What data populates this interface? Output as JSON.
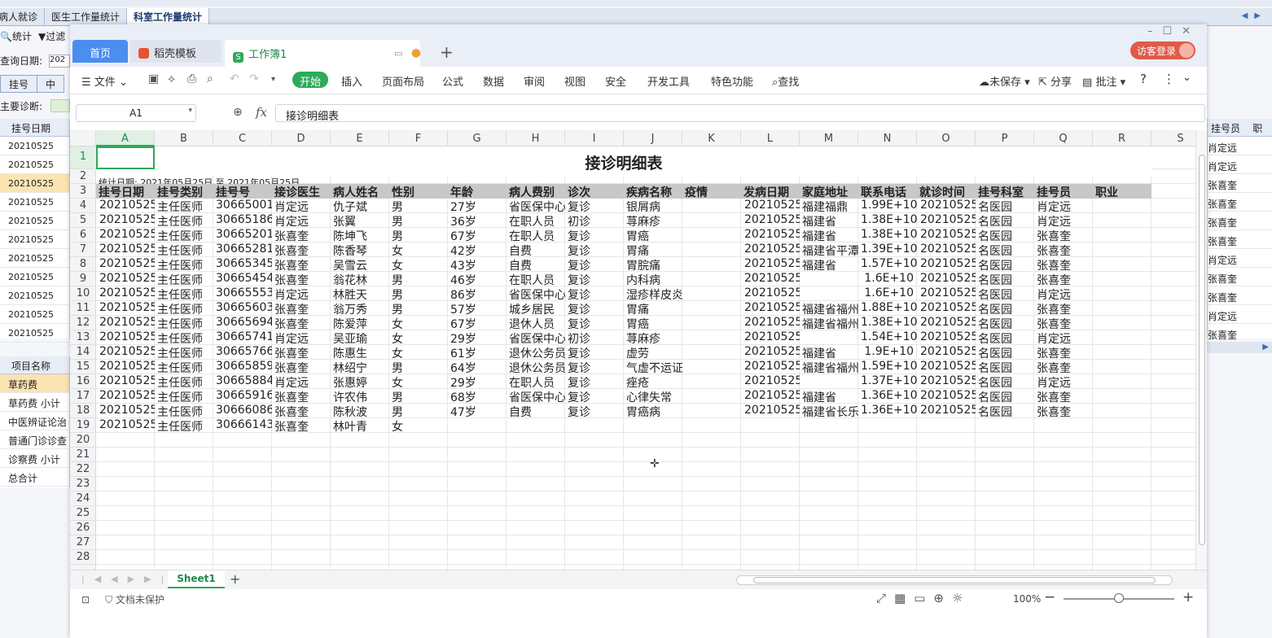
{
  "host": {
    "tabs": [
      "病人就诊",
      "医生工作量统计",
      "科室工作量统计"
    ],
    "toolbar": {
      "stat": "统计",
      "filter": "过滤"
    },
    "query_label": "查询日期:",
    "query_value": "202",
    "subtabs": [
      "挂号",
      "中"
    ],
    "diag_label": "主要诊断:",
    "left_grid": {
      "header": "挂号日期",
      "rows": [
        "20210525",
        "20210525",
        "20210525",
        "20210525",
        "20210525",
        "20210525",
        "20210525",
        "20210525",
        "20210525",
        "20210525",
        "20210525"
      ]
    },
    "right_grid": {
      "header": "挂号员",
      "header2": "职",
      "rows": [
        "肖定远",
        "肖定远",
        "张喜奎",
        "张喜奎",
        "张喜奎",
        "张喜奎",
        "肖定远",
        "张喜奎",
        "张喜奎",
        "肖定远",
        "张喜奎"
      ]
    },
    "items": {
      "header": "项目名称",
      "rows": [
        "草药费",
        "草药费 小计",
        "中医辨证论治",
        "普通门诊诊查",
        "诊察费 小计",
        "总合计"
      ]
    }
  },
  "wps": {
    "tabs": {
      "home": "首页",
      "template": "稻壳模板",
      "workbook": "工作簿1"
    },
    "login": "访客登录",
    "ribbon": {
      "file": "文件",
      "start": "开始",
      "insert": "插入",
      "layout": "页面布局",
      "formula": "公式",
      "data": "数据",
      "review": "审阅",
      "view": "视图",
      "security": "安全",
      "dev": "开发工具",
      "special": "特色功能",
      "search": "查找",
      "unsaved": "未保存",
      "share": "分享",
      "comment": "批注"
    },
    "namebox": "A1",
    "fx": "fx",
    "formula": "接诊明细表",
    "sheet_tab": "Sheet1",
    "status": {
      "doc": "文档未保护",
      "zoom": "100%"
    }
  },
  "sheet": {
    "columns": [
      "A",
      "B",
      "C",
      "D",
      "E",
      "F",
      "G",
      "H",
      "I",
      "J",
      "K",
      "L",
      "M",
      "N",
      "O",
      "P",
      "Q",
      "R",
      "S"
    ],
    "rows": [
      "1",
      "2",
      "3",
      "4",
      "5",
      "6",
      "7",
      "8",
      "9",
      "10",
      "11",
      "12",
      "13",
      "14",
      "15",
      "16",
      "17",
      "18",
      "19",
      "20",
      "21",
      "22",
      "23",
      "24",
      "25",
      "26",
      "27",
      "28"
    ],
    "title": "接诊明细表",
    "stat_line": "统计日期: 2021年05月25日 至 2021年05月25日",
    "headers": [
      "挂号日期",
      "挂号类别",
      "挂号号",
      "接诊医生",
      "病人姓名",
      "性别",
      "年龄",
      "病人费别",
      "诊次",
      "疾病名称",
      "疫情",
      "发病日期",
      "家庭地址",
      "联系电话",
      "就诊时间",
      "挂号科室",
      "挂号员",
      "职业"
    ],
    "data": [
      [
        "20210525",
        "主任医师",
        "30665001",
        "肖定远",
        "仇子斌",
        "男",
        "27岁",
        "省医保中心",
        "复诊",
        "银屑病",
        "",
        "20210525",
        "福建福鼎",
        "1.99E+10",
        "20210525",
        "名医园",
        "肖定远",
        ""
      ],
      [
        "20210525",
        "主任医师",
        "30665186",
        "肖定远",
        "张翼",
        "男",
        "36岁",
        "在职人员",
        "初诊",
        "荨麻疹",
        "",
        "20210525",
        "福建省",
        "1.38E+10",
        "20210525",
        "名医园",
        "肖定远",
        ""
      ],
      [
        "20210525",
        "主任医师",
        "30665201",
        "张喜奎",
        "陈坤飞",
        "男",
        "67岁",
        "在职人员",
        "复诊",
        "胃癌",
        "",
        "20210525",
        "福建省",
        "1.38E+10",
        "20210525",
        "名医园",
        "张喜奎",
        ""
      ],
      [
        "20210525",
        "主任医师",
        "30665281",
        "张喜奎",
        "陈香琴",
        "女",
        "42岁",
        "自费",
        "复诊",
        "胃痛",
        "",
        "20210525",
        "福建省平潭",
        "1.39E+10",
        "20210525",
        "名医园",
        "张喜奎",
        ""
      ],
      [
        "20210525",
        "主任医师",
        "30665345",
        "张喜奎",
        "吴雪云",
        "女",
        "43岁",
        "自费",
        "复诊",
        "胃脘痛",
        "",
        "20210525",
        "福建省",
        "1.57E+10",
        "20210525",
        "名医园",
        "张喜奎",
        ""
      ],
      [
        "20210525",
        "主任医师",
        "30665454",
        "张喜奎",
        "翁花林",
        "男",
        "46岁",
        "在职人员",
        "复诊",
        "内科病",
        "",
        "20210525",
        "",
        "1.6E+10",
        "20210525",
        "名医园",
        "张喜奎",
        ""
      ],
      [
        "20210525",
        "主任医师",
        "30665553",
        "肖定远",
        "林胜天",
        "男",
        "86岁",
        "省医保中心",
        "复诊",
        "湿疹样皮炎",
        "",
        "20210525",
        "",
        "1.6E+10",
        "20210525",
        "名医园",
        "肖定远",
        ""
      ],
      [
        "20210525",
        "主任医师",
        "30665603",
        "张喜奎",
        "翁万秀",
        "男",
        "57岁",
        "城乡居民",
        "复诊",
        "胃痛",
        "",
        "20210525",
        "福建省福州",
        "1.88E+10",
        "20210525",
        "名医园",
        "张喜奎",
        ""
      ],
      [
        "20210525",
        "主任医师",
        "30665694",
        "张喜奎",
        "陈爱萍",
        "女",
        "67岁",
        "退休人员",
        "复诊",
        "胃癌",
        "",
        "20210525",
        "福建省福州",
        "1.38E+10",
        "20210525",
        "名医园",
        "张喜奎",
        ""
      ],
      [
        "20210525",
        "主任医师",
        "30665741",
        "肖定远",
        "吴亚瑜",
        "女",
        "29岁",
        "省医保中心",
        "初诊",
        "荨麻疹",
        "",
        "20210525",
        "",
        "1.54E+10",
        "20210525",
        "名医园",
        "肖定远",
        ""
      ],
      [
        "20210525",
        "主任医师",
        "30665766",
        "张喜奎",
        "陈惠生",
        "女",
        "61岁",
        "退休公务员",
        "复诊",
        "虚劳",
        "",
        "20210525",
        "福建省",
        "1.9E+10",
        "20210525",
        "名医园",
        "张喜奎",
        ""
      ],
      [
        "20210525",
        "主任医师",
        "30665859",
        "张喜奎",
        "林绍宁",
        "男",
        "64岁",
        "退休公务员",
        "复诊",
        "气虚不运证",
        "",
        "20210525",
        "福建省福州",
        "1.59E+10",
        "20210525",
        "名医园",
        "张喜奎",
        ""
      ],
      [
        "20210525",
        "主任医师",
        "30665884",
        "肖定远",
        "张惠婷",
        "女",
        "29岁",
        "在职人员",
        "复诊",
        "痤疮",
        "",
        "20210525",
        "",
        "1.37E+10",
        "20210525",
        "名医园",
        "肖定远",
        ""
      ],
      [
        "20210525",
        "主任医师",
        "30665916",
        "张喜奎",
        "许农伟",
        "男",
        "68岁",
        "省医保中心",
        "复诊",
        "心律失常",
        "",
        "20210525",
        "福建省",
        "1.36E+10",
        "20210525",
        "名医园",
        "张喜奎",
        ""
      ],
      [
        "20210525",
        "主任医师",
        "30666086",
        "张喜奎",
        "陈秋波",
        "男",
        "47岁",
        "自费",
        "复诊",
        "胃癌病",
        "",
        "20210525",
        "福建省长乐",
        "1.36E+10",
        "20210525",
        "名医园",
        "张喜奎",
        ""
      ],
      [
        "20210525",
        "主任医师",
        "30666143",
        "张喜奎",
        "林叶青",
        "女",
        "",
        "",
        "",
        "",
        "",
        "",
        "",
        "",
        "",
        "",
        "",
        ""
      ]
    ]
  }
}
